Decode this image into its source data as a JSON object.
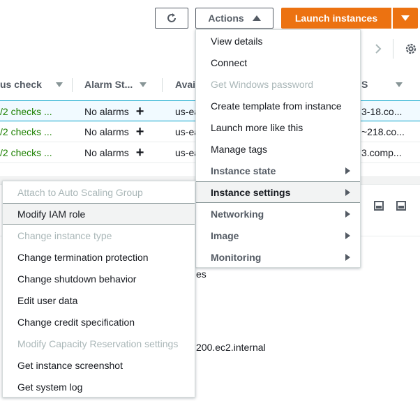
{
  "toolbar": {
    "actions_label": "Actions",
    "launch_label": "Launch instances"
  },
  "table": {
    "headers": [
      "us check",
      "Alarm St...",
      "Avai",
      "S"
    ],
    "rows": [
      {
        "status": "/2 checks ...",
        "alarm": "No alarms",
        "az": "us-ea",
        "dns": "3-18.co..."
      },
      {
        "status": "/2 checks ...",
        "alarm": "No alarms",
        "az": "us-ea",
        "dns": "~218.co..."
      },
      {
        "status": "/2 checks ...",
        "alarm": "No alarms",
        "az": "us-ea",
        "dns": "3.comp..."
      }
    ]
  },
  "details": {
    "fragment_1": "es",
    "fragment_2": "200.ec2.internal"
  },
  "actions_menu": {
    "items": [
      {
        "label": "View details",
        "state": "enabled"
      },
      {
        "label": "Connect",
        "state": "enabled"
      },
      {
        "label": "Get Windows password",
        "state": "disabled"
      },
      {
        "label": "Create template from instance",
        "state": "enabled"
      },
      {
        "label": "Launch more like this",
        "state": "enabled"
      },
      {
        "label": "Manage tags",
        "state": "enabled"
      },
      {
        "label": "Instance state",
        "state": "group"
      },
      {
        "label": "Instance settings",
        "state": "group-active"
      },
      {
        "label": "Networking",
        "state": "group"
      },
      {
        "label": "Image",
        "state": "group"
      },
      {
        "label": "Monitoring",
        "state": "group"
      }
    ]
  },
  "settings_menu": {
    "items": [
      {
        "label": "Attach to Auto Scaling Group",
        "state": "disabled"
      },
      {
        "label": "Modify IAM role",
        "state": "highlighted"
      },
      {
        "label": "Change instance type",
        "state": "disabled"
      },
      {
        "label": "Change termination protection",
        "state": "enabled"
      },
      {
        "label": "Change shutdown behavior",
        "state": "enabled"
      },
      {
        "label": "Edit user data",
        "state": "enabled"
      },
      {
        "label": "Change credit specification",
        "state": "enabled"
      },
      {
        "label": "Modify Capacity Reservation settings",
        "state": "disabled"
      },
      {
        "label": "Get instance screenshot",
        "state": "enabled"
      },
      {
        "label": "Get system log",
        "state": "enabled"
      }
    ]
  },
  "colors": {
    "primary": "#ec7211",
    "status_ok": "#1d8102",
    "selected_row": "#f1faff",
    "disabled_text": "#aab7b8"
  }
}
